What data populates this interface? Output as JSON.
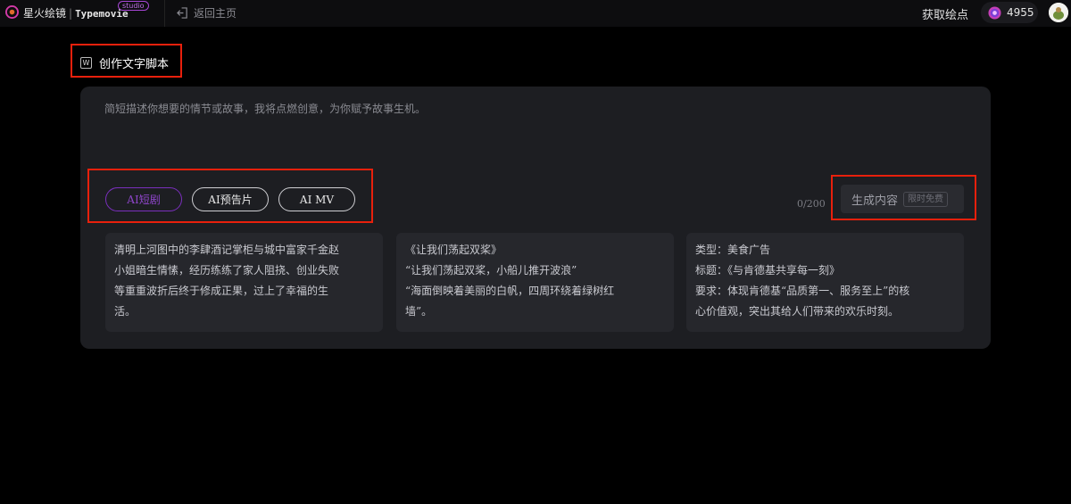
{
  "header": {
    "brand_cn": "星火绘镜",
    "brand_sep": "|",
    "brand_en": "Typemovie",
    "badge": "studio",
    "back_label": "返回主页",
    "get_points": "获取绘点",
    "points": "4955"
  },
  "section": {
    "icon_letter": "W",
    "title": "创作文字脚本"
  },
  "editor": {
    "prompt": "简短描述你想要的情节或故事，我将点燃创意，为你赋予故事生机。",
    "counter": "0/200"
  },
  "chips": [
    {
      "label": "AI短剧",
      "active": true
    },
    {
      "label": "AI预告片",
      "active": false
    },
    {
      "label": "AI MV",
      "active": false
    }
  ],
  "generate": {
    "label": "生成内容",
    "tag": "限时免费"
  },
  "examples": [
    {
      "lines": [
        "清明上河图中的李肆酒记掌柜与城中富家千金赵",
        "小姐暗生情愫，经历练练了家人阻挠、创业失败",
        "等重重波折后终于修成正果，过上了幸福的生",
        "活。"
      ]
    },
    {
      "lines": [
        "《让我们荡起双桨》",
        "“让我们荡起双桨，小船儿推开波浪”",
        "“海面倒映着美丽的白帆，四周环绕着绿树红",
        "墙”。"
      ]
    },
    {
      "lines": [
        "类型：美食广告",
        "标题：《与肯德基共享每一刻》",
        "要求：体现肯德基“品质第一、服务至上”的核",
        "心价值观，突出其给人们带来的欢乐时刻。"
      ]
    }
  ],
  "colors": {
    "accent": "#8e45c9",
    "highlight_box": "#e8200c",
    "card_bg": "#1d1e22"
  }
}
